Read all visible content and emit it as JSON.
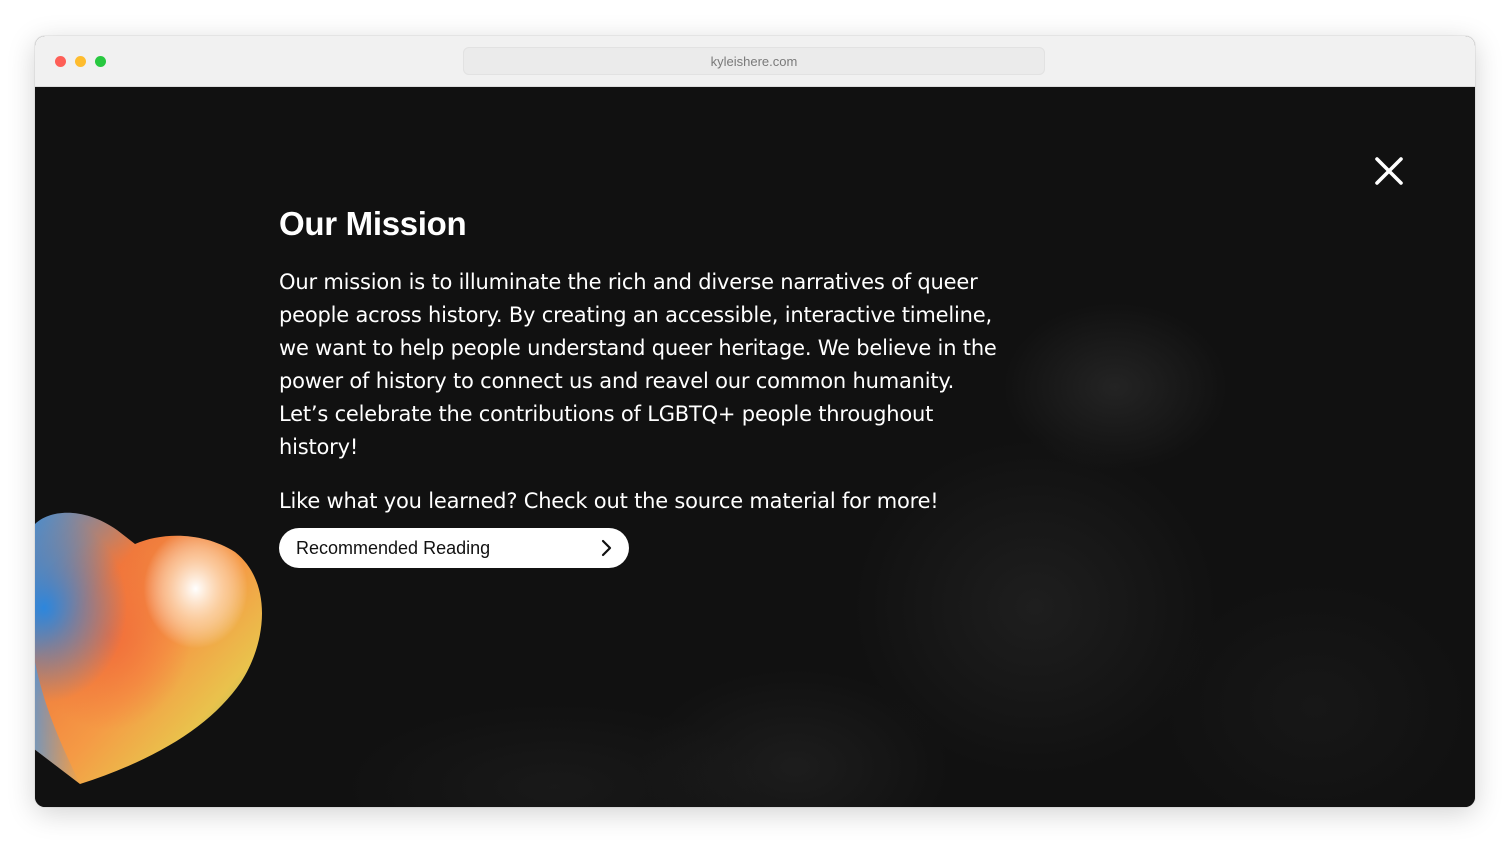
{
  "browser": {
    "url": "kyleishere.com"
  },
  "modal": {
    "title": "Our Mission",
    "body": "Our mission is to illuminate the rich and diverse narratives of queer people across history. By creating an accessible, interactive timeline, we want to help people understand queer heritage. We believe in the power of history to connect us and reavel our common humanity. Let’s celebrate the contributions of LGBTQ+ people throughout history!",
    "cta_text": "Like what you learned? Check out the source material for more!",
    "button_label": "Recommended Reading"
  },
  "icons": {
    "close": "close-icon",
    "chevron": "chevron-right-icon",
    "heart": "rainbow-heart-icon"
  },
  "colors": {
    "background": "#111111",
    "text": "#ffffff",
    "button_bg": "#ffffff",
    "button_text": "#111111"
  }
}
